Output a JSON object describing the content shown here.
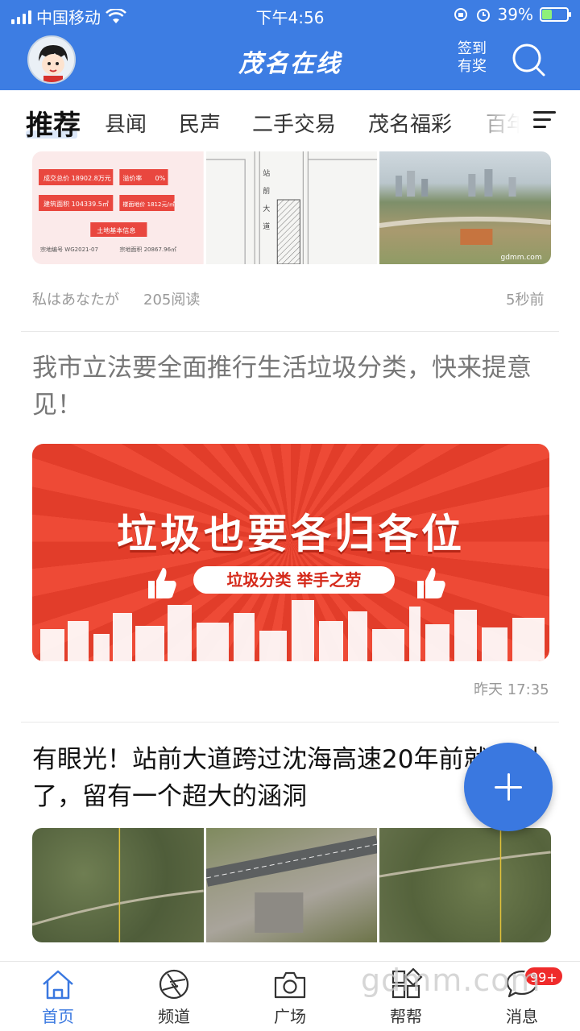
{
  "status_bar": {
    "carrier": "中国移动",
    "time": "下午4:56",
    "battery_percent": "39%",
    "battery_level": 0.39
  },
  "header": {
    "logo": "茂名在线",
    "checkin_line1": "签到",
    "checkin_line2": "有奖"
  },
  "tabs": [
    {
      "label": "推荐",
      "active": true
    },
    {
      "label": "县闻"
    },
    {
      "label": "民声"
    },
    {
      "label": "二手交易"
    },
    {
      "label": "茂名福彩"
    },
    {
      "label": "百年"
    }
  ],
  "feed": {
    "item1": {
      "author": "私はあなたが",
      "reads": "205阅读",
      "time": "5秒前",
      "doc_labels": [
        "成交总价 18902.8万元",
        "溢价率",
        "0%",
        "建筑面积 104339.5㎡",
        "楼面地价 1812元/㎡",
        "土地基本信息",
        "宗地编号 WG2021-07",
        "宗地面积 20867.96㎡"
      ],
      "map_labels": [
        "站",
        "前",
        "大",
        "道"
      ],
      "photo_watermark": "gdmm.com"
    },
    "item2": {
      "title": "我市立法要全面推行生活垃圾分类，快来提意见！",
      "banner_title": "垃圾也要各归各位",
      "banner_sub": "垃圾分类 举手之劳",
      "time": "昨天 17:35"
    },
    "item3": {
      "title": "有眼光！站前大道跨过沈海高速20年前就规划了，留有一个超大的涵洞"
    }
  },
  "bottom_nav": [
    {
      "label": "首页",
      "icon": "home-icon",
      "active": true
    },
    {
      "label": "频道",
      "icon": "aperture-icon"
    },
    {
      "label": "广场",
      "icon": "camera-icon"
    },
    {
      "label": "帮帮",
      "icon": "grid-icon"
    },
    {
      "label": "消息",
      "icon": "chat-icon"
    }
  ],
  "badge": "99+",
  "watermark": "gdmm.com",
  "colors": {
    "primary": "#3d7de3",
    "banner_red": "#e23d2a",
    "badge_red": "#ef2b2b"
  }
}
